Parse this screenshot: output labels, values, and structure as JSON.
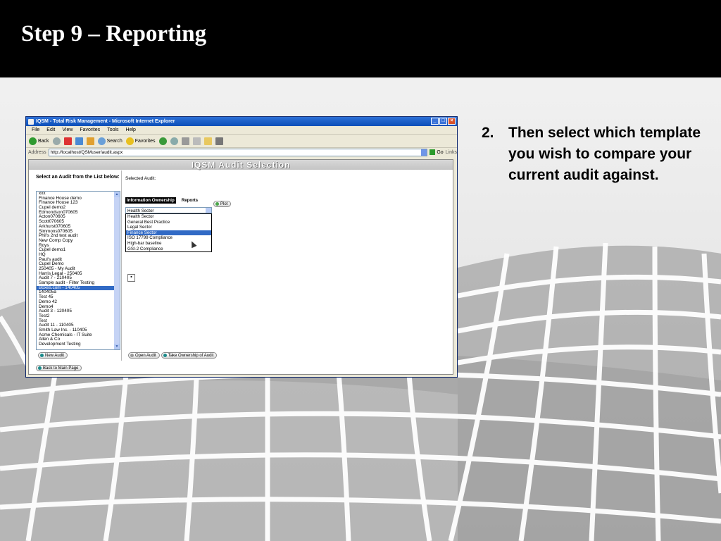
{
  "slide": {
    "title": "Step 9 – Reporting",
    "bullet_number": "2.",
    "bullet_text": "Then select which template you wish to compare your current audit against."
  },
  "browser": {
    "window_title": "IQSM - Total Risk Management - Microsoft Internet Explorer",
    "menu": [
      "File",
      "Edit",
      "View",
      "Favorites",
      "Tools",
      "Help"
    ],
    "toolbar": {
      "back": "Back",
      "search": "Search",
      "favorites": "Favorites"
    },
    "address_label": "Address",
    "address_value": "http://localhost/QSMuser/audit.aspx",
    "go": "Go",
    "links": "Links"
  },
  "app": {
    "header": "IQSM Audit Selection",
    "left_heading": "Select an Audit from the List below:",
    "audits": [
      "xxx",
      "Finance House demo",
      "Finance House 123",
      "Cupel demo2",
      "Edmondson070605",
      "Acton070605",
      "Scott070605",
      "Arkhurst070605",
      "Simmons070605",
      "Phil's 2nd test audit",
      "New Comp Copy",
      "Roys",
      "Cupel demo1",
      "HQ",
      "Paul's audit",
      "Cupel Demo",
      "250405 - My Audit",
      "Harris Legal - 250405",
      "Audit 7 - 210405",
      "Sample audit - Filter Testing",
      "Boxes.com - 140405",
      "140405a",
      "Test 45",
      "Demo 42",
      "Demo4",
      "Audit 3 - 120405",
      "Test2",
      "Test",
      "Audit 11 - 110405",
      "Smith Law Inc. - 110405",
      "Acme Chemicals - IT Suite",
      "Allen & Co",
      "Development Testing"
    ],
    "selected_audit_index": 20,
    "selected_audit_label": "Selected Audit:",
    "tabs": [
      "Information Ownership",
      "Reports"
    ],
    "template_select_value": "Health Sector",
    "template_options": [
      "Health Sector",
      "General Best Practice",
      "Legal Sector",
      "Finance Sector",
      "ISO 17799 Compliance",
      "High-bar baseline",
      "GSI-2 Compliance"
    ],
    "highlighted_option_index": 3,
    "plot_button": "Plot",
    "open_audit_button": "Open Audit",
    "take_ownership_button": "Take Ownership of Audit",
    "new_audit_button": "New Audit",
    "back_main_button": "Back to Main Page"
  }
}
